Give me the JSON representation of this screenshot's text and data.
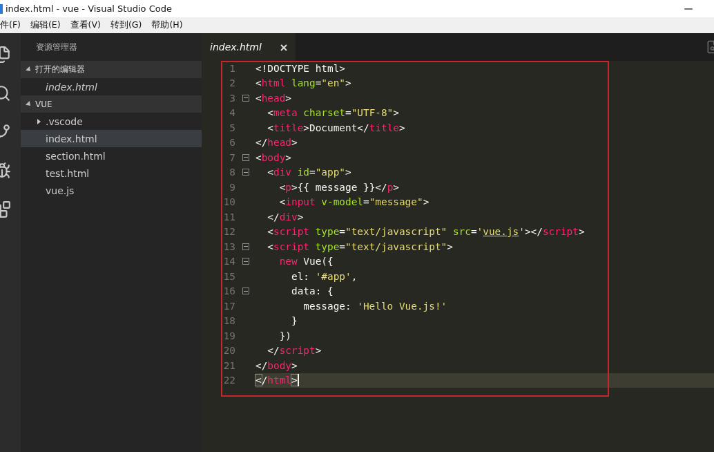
{
  "window": {
    "title": "index.html - vue - Visual Studio Code"
  },
  "menu": [
    "件(F)",
    "编辑(E)",
    "查看(V)",
    "转到(G)",
    "帮助(H)"
  ],
  "sidebar": {
    "title": "资源管理器",
    "sections": [
      {
        "label": "打开的编辑器",
        "expanded": true,
        "items": [
          {
            "label": "index.html",
            "kind": "file",
            "selected": false
          }
        ]
      },
      {
        "label": "VUE",
        "expanded": true,
        "items": [
          {
            "label": ".vscode",
            "kind": "folder",
            "expanded": false,
            "selected": false
          },
          {
            "label": "index.html",
            "kind": "file",
            "selected": true
          },
          {
            "label": "section.html",
            "kind": "file",
            "selected": false
          },
          {
            "label": "test.html",
            "kind": "file",
            "selected": false
          },
          {
            "label": "vue.js",
            "kind": "file",
            "selected": false
          }
        ]
      }
    ]
  },
  "tabs": [
    {
      "label": "index.html",
      "selected": true
    }
  ],
  "editor": {
    "lines": [
      {
        "number": "1",
        "foldable": false,
        "current": false,
        "tokens": [
          {
            "kind": "punct",
            "text": "<!DOCTYPE html>"
          }
        ]
      },
      {
        "number": "2",
        "foldable": false,
        "current": false,
        "tokens": [
          {
            "kind": "punct",
            "text": "<"
          },
          {
            "kind": "tag",
            "text": "html"
          },
          {
            "kind": "attr",
            "text": " lang"
          },
          {
            "kind": "punct",
            "text": "="
          },
          {
            "kind": "string",
            "text": "\"en\""
          },
          {
            "kind": "punct",
            "text": ">"
          }
        ]
      },
      {
        "number": "3",
        "foldable": true,
        "current": false,
        "tokens": [
          {
            "kind": "punct",
            "text": "<"
          },
          {
            "kind": "tag",
            "text": "head"
          },
          {
            "kind": "punct",
            "text": ">"
          }
        ]
      },
      {
        "number": "4",
        "foldable": false,
        "current": false,
        "tokens": [
          {
            "kind": "punct",
            "text": "  <"
          },
          {
            "kind": "tag",
            "text": "meta"
          },
          {
            "kind": "attr",
            "text": " charset"
          },
          {
            "kind": "punct",
            "text": "="
          },
          {
            "kind": "string",
            "text": "\"UTF-8\""
          },
          {
            "kind": "punct",
            "text": ">"
          }
        ]
      },
      {
        "number": "5",
        "foldable": false,
        "current": false,
        "tokens": [
          {
            "kind": "punct",
            "text": "  <"
          },
          {
            "kind": "tag",
            "text": "title"
          },
          {
            "kind": "punct",
            "text": ">Document</"
          },
          {
            "kind": "tag",
            "text": "title"
          },
          {
            "kind": "punct",
            "text": ">"
          }
        ]
      },
      {
        "number": "6",
        "foldable": false,
        "current": false,
        "tokens": [
          {
            "kind": "punct",
            "text": "</"
          },
          {
            "kind": "tag",
            "text": "head"
          },
          {
            "kind": "punct",
            "text": ">"
          }
        ]
      },
      {
        "number": "7",
        "foldable": true,
        "current": false,
        "tokens": [
          {
            "kind": "punct",
            "text": "<"
          },
          {
            "kind": "tag",
            "text": "body"
          },
          {
            "kind": "punct",
            "text": ">"
          }
        ]
      },
      {
        "number": "8",
        "foldable": true,
        "current": false,
        "tokens": [
          {
            "kind": "punct",
            "text": "  <"
          },
          {
            "kind": "tag",
            "text": "div"
          },
          {
            "kind": "attr",
            "text": " id"
          },
          {
            "kind": "punct",
            "text": "="
          },
          {
            "kind": "string",
            "text": "\"app\""
          },
          {
            "kind": "punct",
            "text": ">"
          }
        ]
      },
      {
        "number": "9",
        "foldable": false,
        "current": false,
        "tokens": [
          {
            "kind": "punct",
            "text": "    <"
          },
          {
            "kind": "tag",
            "text": "p"
          },
          {
            "kind": "punct",
            "text": ">{{ message }}</"
          },
          {
            "kind": "tag",
            "text": "p"
          },
          {
            "kind": "punct",
            "text": ">"
          }
        ]
      },
      {
        "number": "10",
        "foldable": false,
        "current": false,
        "tokens": [
          {
            "kind": "punct",
            "text": "    <"
          },
          {
            "kind": "tag",
            "text": "input"
          },
          {
            "kind": "attr",
            "text": " v-model"
          },
          {
            "kind": "punct",
            "text": "="
          },
          {
            "kind": "string",
            "text": "\"message\""
          },
          {
            "kind": "punct",
            "text": ">"
          }
        ]
      },
      {
        "number": "11",
        "foldable": false,
        "current": false,
        "tokens": [
          {
            "kind": "punct",
            "text": "  </"
          },
          {
            "kind": "tag",
            "text": "div"
          },
          {
            "kind": "punct",
            "text": ">"
          }
        ]
      },
      {
        "number": "12",
        "foldable": false,
        "current": false,
        "tokens": [
          {
            "kind": "punct",
            "text": "  <"
          },
          {
            "kind": "tag",
            "text": "script"
          },
          {
            "kind": "attr",
            "text": " type"
          },
          {
            "kind": "punct",
            "text": "="
          },
          {
            "kind": "string",
            "text": "\"text/javascript\""
          },
          {
            "kind": "attr",
            "text": " src"
          },
          {
            "kind": "punct",
            "text": "="
          },
          {
            "kind": "string",
            "text": "'"
          },
          {
            "kind": "link",
            "text": "vue.js"
          },
          {
            "kind": "string",
            "text": "'"
          },
          {
            "kind": "punct",
            "text": "></"
          },
          {
            "kind": "tag",
            "text": "script"
          },
          {
            "kind": "punct",
            "text": ">"
          }
        ]
      },
      {
        "number": "13",
        "foldable": true,
        "current": false,
        "tokens": [
          {
            "kind": "punct",
            "text": "  <"
          },
          {
            "kind": "tag",
            "text": "script"
          },
          {
            "kind": "attr",
            "text": " type"
          },
          {
            "kind": "punct",
            "text": "="
          },
          {
            "kind": "string",
            "text": "\"text/javascript\""
          },
          {
            "kind": "punct",
            "text": ">"
          }
        ]
      },
      {
        "number": "14",
        "foldable": true,
        "current": false,
        "tokens": [
          {
            "kind": "keyword",
            "text": "    new"
          },
          {
            "kind": "punct",
            "text": " Vue({"
          }
        ]
      },
      {
        "number": "15",
        "foldable": false,
        "current": false,
        "tokens": [
          {
            "kind": "punct",
            "text": "      el: "
          },
          {
            "kind": "string",
            "text": "'#app'"
          },
          {
            "kind": "punct",
            "text": ","
          }
        ]
      },
      {
        "number": "16",
        "foldable": true,
        "current": false,
        "tokens": [
          {
            "kind": "punct",
            "text": "      data: {"
          }
        ]
      },
      {
        "number": "17",
        "foldable": false,
        "current": false,
        "tokens": [
          {
            "kind": "punct",
            "text": "        message: "
          },
          {
            "kind": "string",
            "text": "'Hello Vue.js!'"
          }
        ]
      },
      {
        "number": "18",
        "foldable": false,
        "current": false,
        "tokens": [
          {
            "kind": "punct",
            "text": "      }"
          }
        ]
      },
      {
        "number": "19",
        "foldable": false,
        "current": false,
        "tokens": [
          {
            "kind": "punct",
            "text": "    })"
          }
        ]
      },
      {
        "number": "20",
        "foldable": false,
        "current": false,
        "tokens": [
          {
            "kind": "punct",
            "text": "  </"
          },
          {
            "kind": "tag",
            "text": "script"
          },
          {
            "kind": "punct",
            "text": ">"
          }
        ]
      },
      {
        "number": "21",
        "foldable": false,
        "current": false,
        "tokens": [
          {
            "kind": "punct",
            "text": "</"
          },
          {
            "kind": "tag",
            "text": "body"
          },
          {
            "kind": "punct",
            "text": ">"
          }
        ]
      },
      {
        "number": "22",
        "foldable": false,
        "current": true,
        "tokens": [
          {
            "kind": "match",
            "text": "<"
          },
          {
            "kind": "punct",
            "text": "/"
          },
          {
            "kind": "tag",
            "text": "html"
          },
          {
            "kind": "match",
            "text": ">"
          }
        ]
      }
    ]
  }
}
